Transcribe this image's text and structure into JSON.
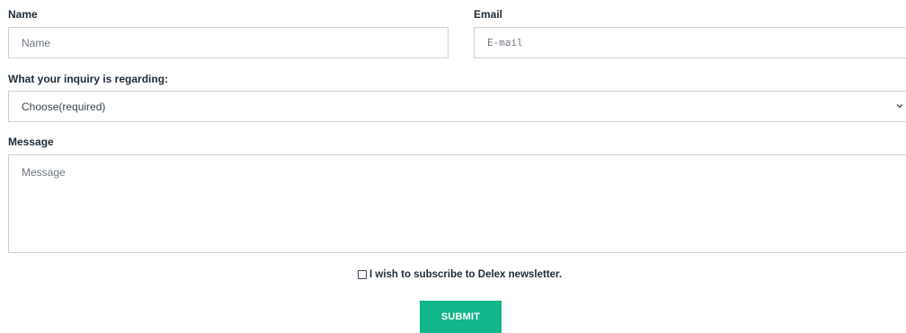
{
  "form": {
    "name": {
      "label": "Name",
      "placeholder": "Name"
    },
    "email": {
      "label": "Email",
      "placeholder": "E-mail"
    },
    "inquiry": {
      "label": "What your inquiry is regarding:",
      "selected": "Choose(required)"
    },
    "message": {
      "label": "Message",
      "placeholder": "Message"
    },
    "newsletter": {
      "label": "I wish to subscribe to Delex newsletter.",
      "checked": false
    },
    "submit_label": "SUBMIT"
  },
  "colors": {
    "accent": "#12b78b",
    "border": "#cfd3d6",
    "label_text": "#1e2b36",
    "placeholder_text": "#6f7780"
  },
  "icons": {
    "select_arrow": "chevron-down-icon"
  }
}
